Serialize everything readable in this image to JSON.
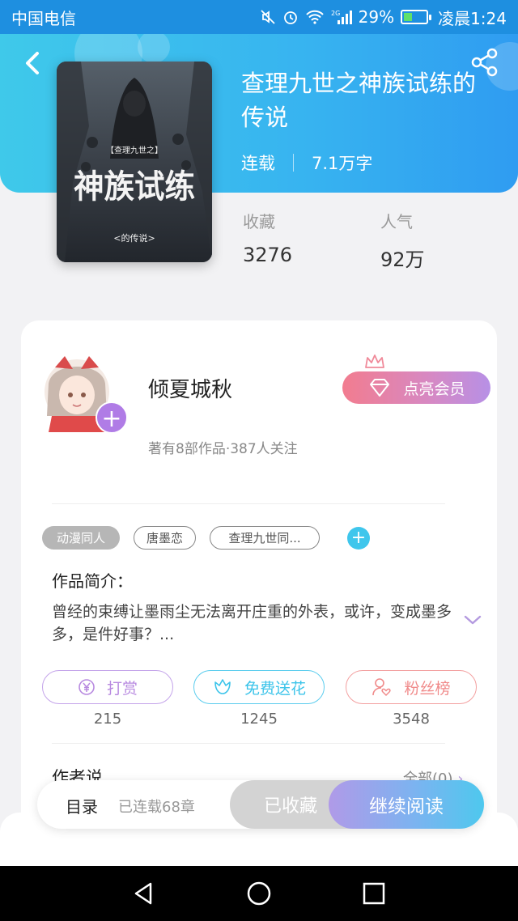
{
  "status_bar": {
    "carrier": "中国电信",
    "battery": "29%",
    "signal": "2G",
    "time_label": "凌晨1:24"
  },
  "book": {
    "title": "查理九世之神族试练的传说",
    "status": "连载",
    "word_count": "7.1万字",
    "cover_text": {
      "small": "【查理九世之】",
      "big": "神族试练",
      "bottom": "<的传说>"
    }
  },
  "stats": [
    {
      "label": "收藏",
      "value": "3276"
    },
    {
      "label": "人气",
      "value": "92万"
    }
  ],
  "author": {
    "name": "倾夏城秋",
    "sub": "著有8部作品·387人关注",
    "vip_label": "点亮会员"
  },
  "tags": [
    "动漫同人",
    "唐墨恋",
    "查理九世同..."
  ],
  "intro": {
    "heading": "作品简介：",
    "text": "曾经的束缚让墨雨尘无法离开庄重的外表，或许，变成墨多多，是件好事？..."
  },
  "actions": [
    {
      "label": "打赏",
      "count": "215",
      "color": "#b88ae0",
      "icon": "yen-coin-icon"
    },
    {
      "label": "免费送花",
      "count": "1245",
      "color": "#3cc4ea",
      "icon": "flower-icon"
    },
    {
      "label": "粉丝榜",
      "count": "3548",
      "color": "#f08a8a",
      "icon": "fan-user-icon"
    }
  ],
  "author_says": {
    "heading": "作者说",
    "all_link": "全部(0)"
  },
  "bottom_bar": {
    "toc": "目录",
    "chapters": "已连载68章",
    "collected": "已收藏",
    "continue": "继续阅读"
  },
  "colors": {
    "hero_start": "#3fc9ea",
    "hero_end": "#2f9cf1",
    "vip": "#f27c8f",
    "accent_purple": "#b07ce6"
  }
}
